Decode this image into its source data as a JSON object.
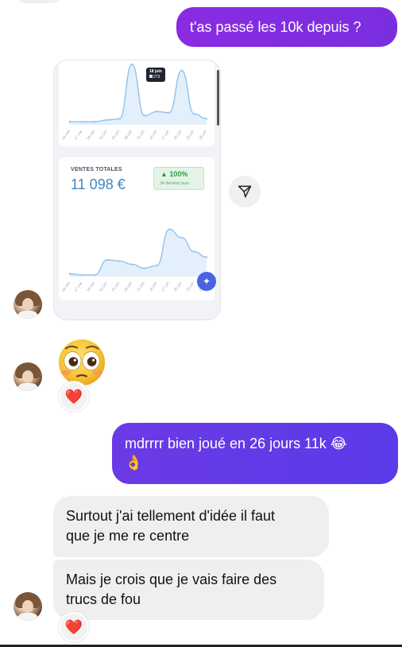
{
  "messages": {
    "outgoing_1": "t'as passé les 10k depuis ?",
    "outgoing_2": "mdrrrr bien joué en 26 jours 11k 😂",
    "outgoing_2_emoji": "👌",
    "incoming_1_line1": "Surtout j'ai tellement d'idée il faut",
    "incoming_1_line2": "que je me re centre",
    "incoming_2_line1": "Mais je crois que je vais faire des",
    "incoming_2_line2": "trucs de fou"
  },
  "reactions": {
    "emoji_reaction": "❤️",
    "text_reaction": "❤️"
  },
  "screenshot": {
    "tooltip_date": "18 juin",
    "tooltip_value": "273",
    "sales_label": "VENTES TOTALES",
    "sales_value": "11 098 €",
    "badge_pct": "▲ 100%",
    "badge_sub": "34 derniers jours",
    "ticks_top": [
      "24 mai",
      "27 mai",
      "30 mai",
      "02 juin",
      "05 juin",
      "08 juin",
      "11 juin",
      "14 juin",
      "17 juin",
      "20 juin",
      "23 juin",
      "26 juin"
    ],
    "ticks_bottom": [
      "24 mai",
      "27 mai",
      "30 mai",
      "02 juin",
      "05 juin",
      "08 juin",
      "11 juin",
      "14 juin",
      "17 juin",
      "20 juin",
      "23 juin",
      "26 juin"
    ]
  },
  "chart_data": [
    {
      "type": "area",
      "categories": [
        "24 mai",
        "27 mai",
        "30 mai",
        "02 juin",
        "05 juin",
        "08 juin",
        "11 juin",
        "14 juin",
        "17 juin",
        "20 juin",
        "23 juin",
        "26 juin"
      ],
      "values": [
        5,
        5,
        5,
        8,
        10,
        100,
        15,
        22,
        20,
        90,
        18,
        10
      ]
    },
    {
      "type": "area",
      "title": "VENTES TOTALES",
      "categories": [
        "24 mai",
        "27 mai",
        "30 mai",
        "02 juin",
        "05 juin",
        "08 juin",
        "11 juin",
        "14 juin",
        "17 juin",
        "20 juin",
        "23 juin",
        "26 juin"
      ],
      "values": [
        5,
        3,
        3,
        30,
        28,
        22,
        15,
        20,
        85,
        70,
        45,
        35
      ]
    }
  ],
  "colors": {
    "outgoing_purple_1": "#8a2be2",
    "outgoing_purple_2": "#5b3ae8",
    "incoming_gray": "#efeff1",
    "chart_line": "#8ec2ec",
    "sales_blue": "#3d86c6",
    "badge_green": "#2e9b4a"
  },
  "icons": {
    "share": "send-icon",
    "sparkle": "sparkle-icon",
    "emoji": "flushed-face-emoji"
  }
}
